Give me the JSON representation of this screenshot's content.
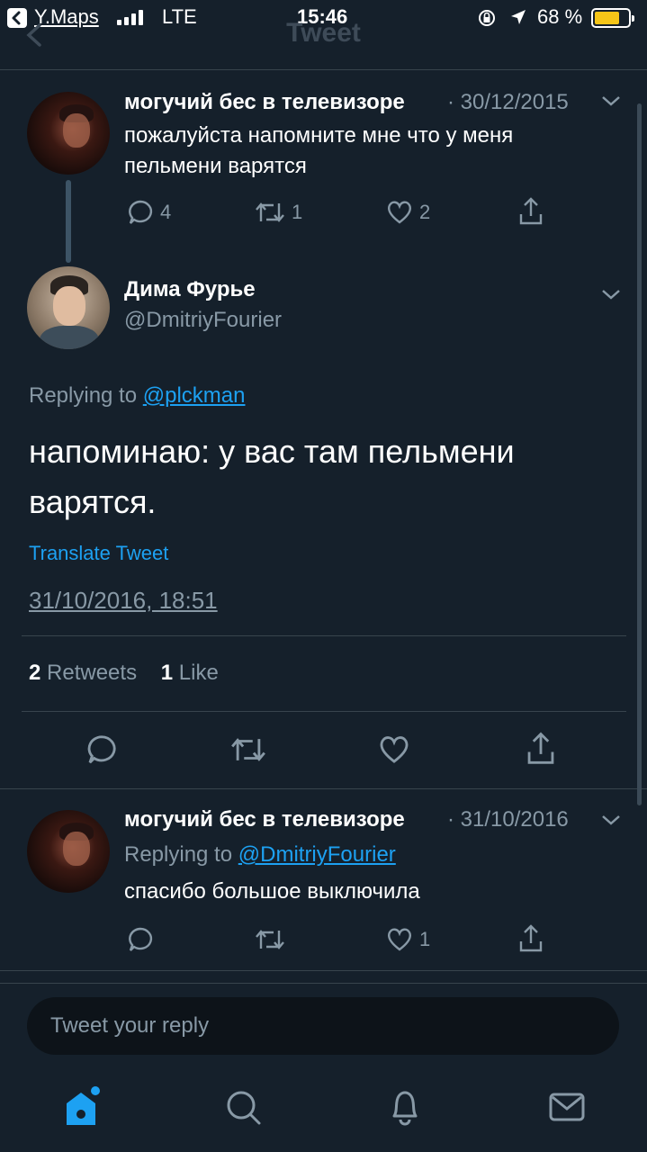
{
  "status_bar": {
    "back_app": "Y.Maps",
    "network": "LTE",
    "time": "15:46",
    "battery_text": "68 %",
    "battery_level": 0.68
  },
  "nav": {
    "title": "Tweet"
  },
  "tweets": [
    {
      "name": "могучий бес в телевизоре",
      "date": "· 30/12/2015",
      "text": "пожалуйста напомните мне что у меня пельмени варятся",
      "replies": "4",
      "retweets": "1",
      "likes": "2"
    }
  ],
  "main_tweet": {
    "name": "Дима Фурье",
    "handle": "@DmitriyFourier",
    "replying_label": "Replying to",
    "replying_handle": "@plckman",
    "text": "напоминаю: у вас там пельмени варятся.",
    "translate": "Translate Tweet",
    "datetime": "31/10/2016, 18:51",
    "retweet_count": "2",
    "retweet_label": "Retweets",
    "like_count": "1",
    "like_label": "Like"
  },
  "reply_tweet": {
    "name": "могучий бес в телевизоре",
    "date": "· 31/10/2016",
    "replying_label": "Replying to",
    "replying_handle": "@DmitriyFourier",
    "text": "спасибо большое выключила",
    "likes": "1"
  },
  "reply_box": {
    "placeholder": "Tweet your reply"
  },
  "tabs": [
    "home-icon",
    "search-icon",
    "notifications-icon",
    "messages-icon"
  ],
  "colors": {
    "background": "#15202b",
    "accent": "#1da1f2",
    "muted": "#8899a6",
    "battery": "#f5c518"
  }
}
